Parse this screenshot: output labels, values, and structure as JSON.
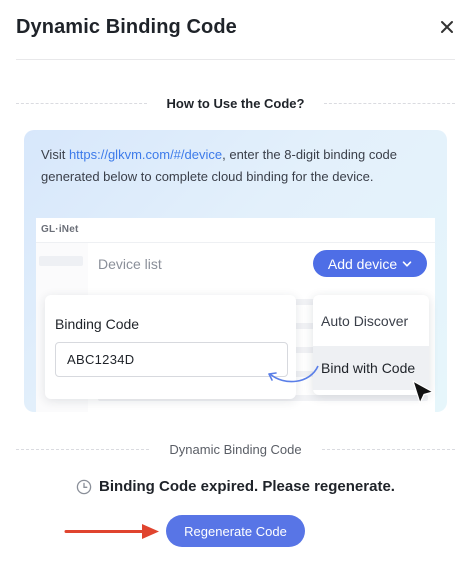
{
  "dialog": {
    "title": "Dynamic Binding Code",
    "close_icon": "close-icon"
  },
  "howto": {
    "heading": "How to Use the Code?",
    "text_before_link": "Visit ",
    "link_text": "https://glkvm.com/#/device",
    "text_after_link": ", enter the 8-digit binding code generated below to complete cloud binding for the device."
  },
  "illustration": {
    "logo": "GL·iNet",
    "page_title": "Device list",
    "add_device_label": "Add device",
    "menu_items": [
      "Auto Discover",
      "Bind with Code"
    ],
    "binding_code_label": "Binding Code",
    "binding_code_value": "ABC1234D"
  },
  "code_section": {
    "heading": "Dynamic Binding Code",
    "status_icon": "clock-icon",
    "status_text": "Binding Code expired. Please regenerate.",
    "regenerate_label": "Regenerate Code"
  },
  "colors": {
    "accent": "#5875e6",
    "link": "#3d7bea",
    "pointer_arrow": "#e0442f"
  }
}
